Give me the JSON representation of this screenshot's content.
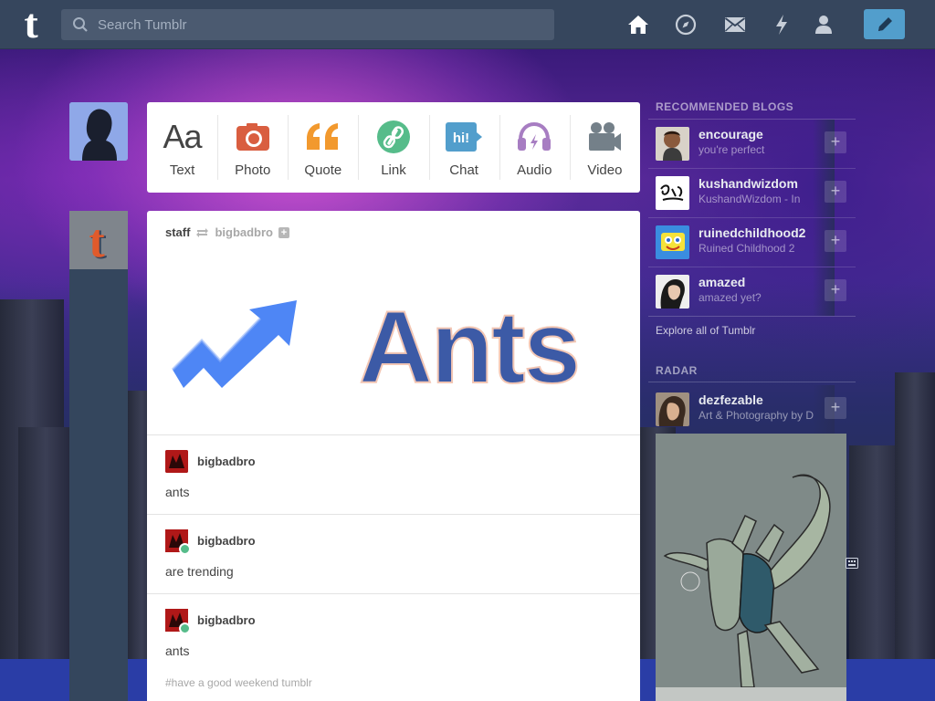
{
  "search": {
    "placeholder": "Search Tumblr"
  },
  "nav": {
    "icons": [
      "home-icon",
      "explore-icon",
      "inbox-icon",
      "activity-icon",
      "account-icon"
    ],
    "compose_icon": "pencil-icon",
    "colors": {
      "bar": "#36465d",
      "compose": "#529ecc"
    }
  },
  "post_types": [
    {
      "label": "Text",
      "icon": "text-icon",
      "color": "#444444"
    },
    {
      "label": "Photo",
      "icon": "photo-icon",
      "color": "#d95e40"
    },
    {
      "label": "Quote",
      "icon": "quote-icon",
      "color": "#f2992e"
    },
    {
      "label": "Link",
      "icon": "link-icon",
      "color": "#56bc8a"
    },
    {
      "label": "Chat",
      "icon": "chat-icon",
      "color": "#529ecc"
    },
    {
      "label": "Audio",
      "icon": "audio-icon",
      "color": "#a77dc2"
    },
    {
      "label": "Video",
      "icon": "video-icon",
      "color": "#748089"
    }
  ],
  "post": {
    "author": "staff",
    "reblogged_from": "bigbadbro",
    "image_text": "Ants",
    "reblogs": [
      {
        "name": "bigbadbro",
        "text": "ants"
      },
      {
        "name": "bigbadbro",
        "text": "are trending"
      },
      {
        "name": "bigbadbro",
        "text": "ants"
      }
    ],
    "tags": "#have a good weekend tumblr"
  },
  "sidebar": {
    "recommended_title": "RECOMMENDED BLOGS",
    "blogs": [
      {
        "name": "encourage",
        "title": "you're perfect"
      },
      {
        "name": "kushandwizdom",
        "title": "KushandWizdom - In"
      },
      {
        "name": "ruinedchildhood2",
        "title": "Ruined Childhood 2"
      },
      {
        "name": "amazed",
        "title": "amazed yet?"
      }
    ],
    "explore_label": "Explore all of Tumblr",
    "radar_title": "RADAR",
    "radar": {
      "name": "dezfezable",
      "title": "Art & Photography by D"
    }
  }
}
